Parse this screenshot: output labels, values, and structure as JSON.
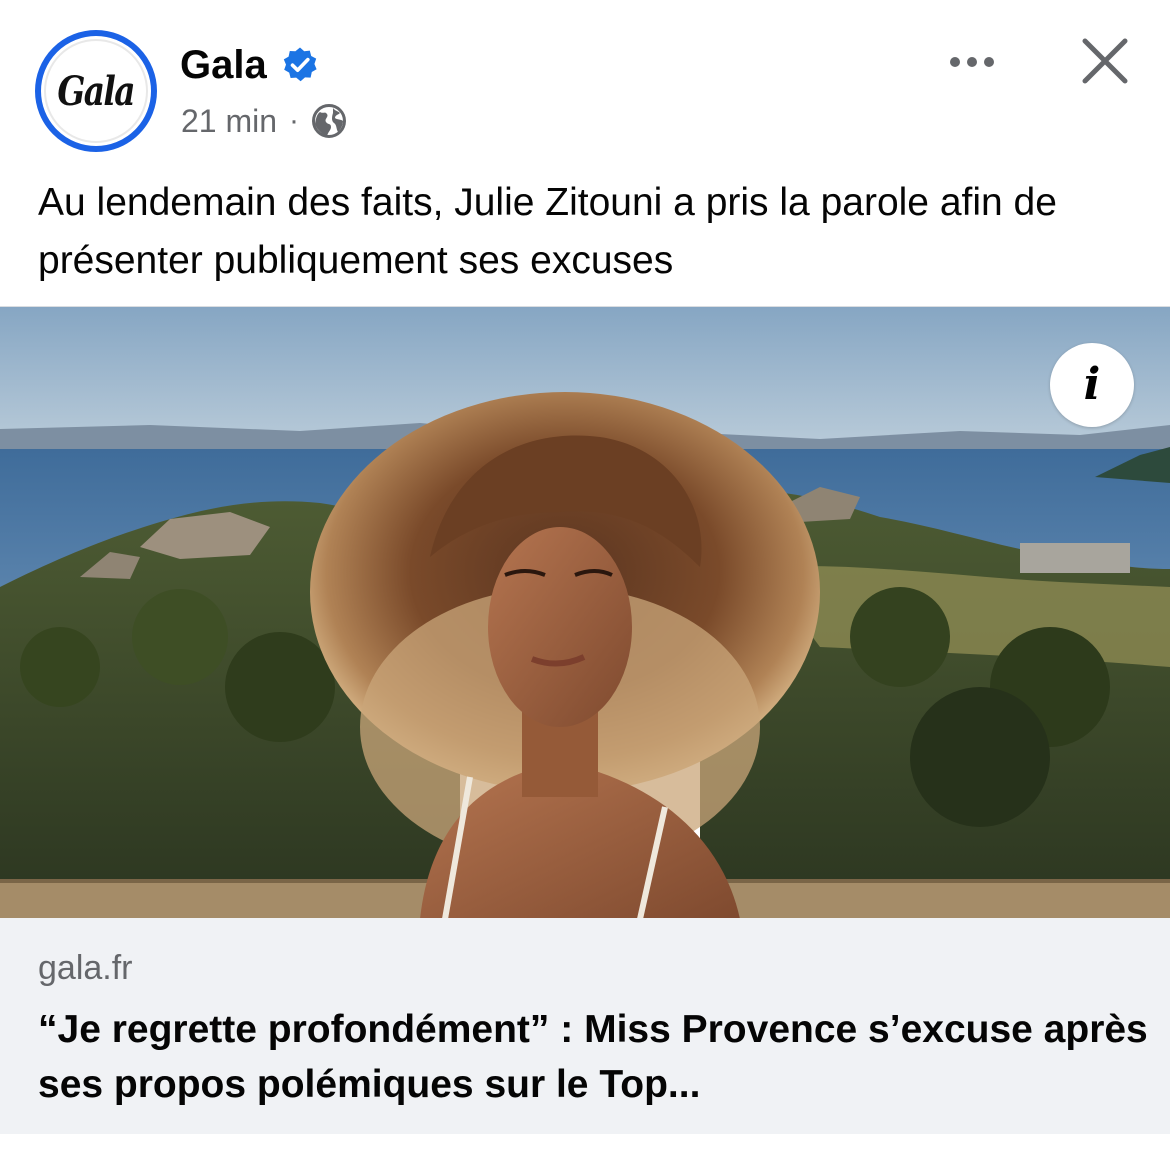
{
  "header": {
    "avatar_text": "Gala",
    "page_name": "Gala",
    "timestamp": "21 min",
    "separator": "·",
    "verified_color": "#1b74e4",
    "avatar_ring_color": "#1b62e6"
  },
  "post": {
    "caption": "Au lendemain des faits, Julie Zitouni a pris la parole afin de présenter publiquement ses excuses"
  },
  "image": {
    "info_glyph": "i"
  },
  "link_preview": {
    "domain": "gala.fr",
    "headline": "“Je regrette profondément” : Miss Provence s’excuse après ses propos polémiques sur le Top..."
  },
  "icons": {
    "more": "more-horizontal-icon",
    "close": "close-icon",
    "globe": "globe-icon",
    "verified": "verified-badge-icon",
    "info": "info-icon"
  }
}
